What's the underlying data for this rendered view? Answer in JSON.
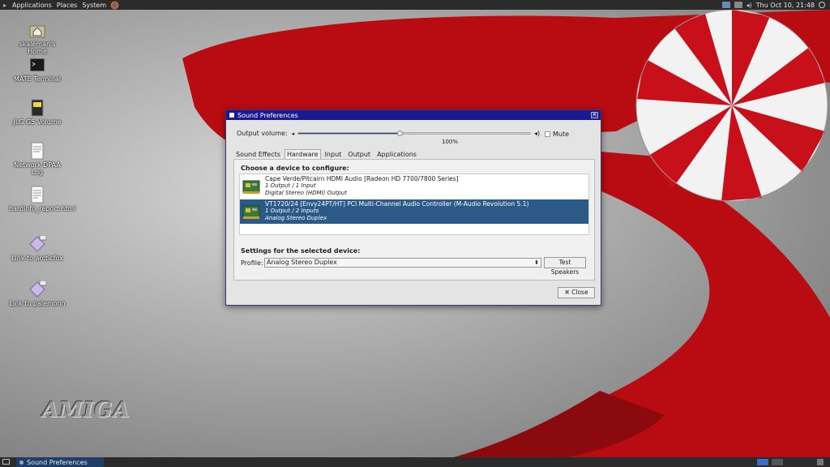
{
  "top_panel": {
    "menus": [
      "Applications",
      "Places",
      "System"
    ],
    "clock": "Thu Oct 10, 21:48"
  },
  "desktop_icons": [
    {
      "label": "skaleman's Home",
      "icon": "home-folder-icon"
    },
    {
      "label": "MATE Terminal",
      "icon": "terminal-icon"
    },
    {
      "label": "JLG G5 Volume",
      "icon": "drive-icon"
    },
    {
      "label": "Network DPAA Log",
      "icon": "text-file-icon"
    },
    {
      "label": "hardinfo_report.html",
      "icon": "html-file-icon"
    },
    {
      "label": "Link to arcticfox",
      "icon": "link-icon"
    },
    {
      "label": "Link to palemoon",
      "icon": "link-icon"
    }
  ],
  "logo_text": "AMIGA",
  "window": {
    "title": "Sound Preferences",
    "output_volume_label": "Output volume:",
    "volume_percent_text": "100%",
    "volume_fraction": 0.44,
    "mute_label": "Mute",
    "tabs": [
      "Sound Effects",
      "Hardware",
      "Input",
      "Output",
      "Applications"
    ],
    "active_tab": "Hardware",
    "choose_label": "Choose a device to configure:",
    "devices": [
      {
        "name": "Cape Verde/Pitcairn HDMI Audio [Radeon HD 7700/7800 Series]",
        "io": "1 Output / 1 Input",
        "profile": "Digital Stereo (HDMI) Output",
        "selected": false
      },
      {
        "name": "VT1720/24 [Envy24PT/HT] PCI Multi-Channel Audio Controller (M-Audio Revolution 5.1)",
        "io": "1 Output / 2 Inputs",
        "profile": "Analog Stereo Duplex",
        "selected": true
      }
    ],
    "settings_label": "Settings for the selected device:",
    "profile_label": "Profile:",
    "profile_value": "Analog Stereo Duplex",
    "test_speakers_label": "Test Speakers",
    "close_label": "Close"
  },
  "taskbar": {
    "items": [
      "Sound Preferences"
    ]
  },
  "colors": {
    "title_bar": "#1a1a90",
    "selection": "#2b5a88",
    "wallpaper_red": "#b80c12"
  }
}
